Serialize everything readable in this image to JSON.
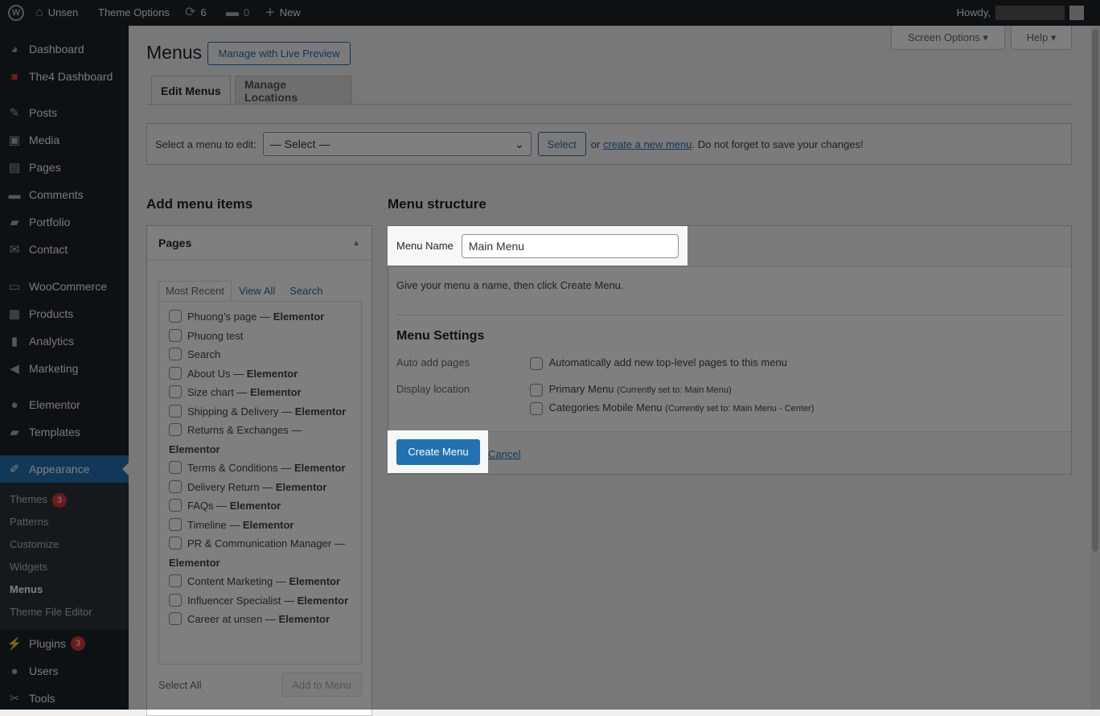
{
  "adminbar": {
    "site": "Unsen",
    "theme_options": "Theme Options",
    "updates": "6",
    "comments": "0",
    "new": "New",
    "howdy": "Howdy,"
  },
  "sidebar": [
    {
      "label": "Dashboard",
      "icon": "dashboard-icon",
      "glyph": "◕"
    },
    {
      "label": "The4 Dashboard",
      "icon": "the4-logo-icon",
      "glyph": "■",
      "sepAfter": true
    },
    {
      "label": "Posts",
      "icon": "pin-icon",
      "glyph": "✎"
    },
    {
      "label": "Media",
      "icon": "media-icon",
      "glyph": "▣"
    },
    {
      "label": "Pages",
      "icon": "pages-icon",
      "glyph": "▤"
    },
    {
      "label": "Comments",
      "icon": "comment-icon",
      "glyph": "▬"
    },
    {
      "label": "Portfolio",
      "icon": "folder-icon",
      "glyph": "▰"
    },
    {
      "label": "Contact",
      "icon": "mail-icon",
      "glyph": "✉",
      "sepAfter": true
    },
    {
      "label": "WooCommerce",
      "icon": "woo-icon",
      "glyph": "▭"
    },
    {
      "label": "Products",
      "icon": "archive-icon",
      "glyph": "▦"
    },
    {
      "label": "Analytics",
      "icon": "chart-icon",
      "glyph": "▮"
    },
    {
      "label": "Marketing",
      "icon": "megaphone-icon",
      "glyph": "◀",
      "sepAfter": true
    },
    {
      "label": "Elementor",
      "icon": "elementor-icon",
      "glyph": "●"
    },
    {
      "label": "Templates",
      "icon": "folder-icon",
      "glyph": "▰",
      "sepAfter": true
    },
    {
      "label": "Appearance",
      "icon": "brush-icon",
      "glyph": "✐",
      "current": true,
      "sub": [
        {
          "label": "Themes",
          "badge": "3"
        },
        {
          "label": "Patterns"
        },
        {
          "label": "Customize"
        },
        {
          "label": "Widgets"
        },
        {
          "label": "Menus",
          "active": true
        },
        {
          "label": "Theme File Editor"
        }
      ]
    },
    {
      "label": "Plugins",
      "icon": "plugin-icon",
      "glyph": "⚡",
      "badge": "3"
    },
    {
      "label": "Users",
      "icon": "user-icon",
      "glyph": "●"
    },
    {
      "label": "Tools",
      "icon": "wrench-icon",
      "glyph": "✂"
    }
  ],
  "header": {
    "title": "Menus",
    "live_preview": "Manage with Live Preview",
    "screen_options": "Screen Options ▾",
    "help": "Help ▾"
  },
  "tabs": {
    "edit": "Edit Menus",
    "locations": "Manage Locations"
  },
  "select_bar": {
    "label": "Select a menu to edit:",
    "value": "— Select —",
    "button": "Select",
    "or": "or",
    "create_link": "create a new menu",
    "suffix": ". Do not forget to save your changes!"
  },
  "add_items": {
    "title": "Add menu items",
    "panel": "Pages",
    "tabs": [
      "Most Recent",
      "View All",
      "Search"
    ],
    "pages": [
      [
        "Phuong’s page",
        "Elementor"
      ],
      [
        "Phuong test",
        ""
      ],
      [
        "Search",
        ""
      ],
      [
        "About Us",
        "Elementor"
      ],
      [
        "Size chart",
        "Elementor"
      ],
      [
        "Shipping & Delivery",
        "Elementor"
      ],
      [
        "Returns & Exchanges",
        "Elementor"
      ],
      [
        "Terms & Conditions",
        "Elementor"
      ],
      [
        "Delivery Return",
        "Elementor"
      ],
      [
        "FAQs",
        "Elementor"
      ],
      [
        "Timeline",
        "Elementor"
      ],
      [
        "PR & Communication Manager",
        "Elementor"
      ],
      [
        "Content Marketing",
        "Elementor"
      ],
      [
        "Influencer Specialist",
        "Elementor"
      ],
      [
        "Career at unsen",
        "Elementor"
      ]
    ],
    "select_all": "Select All",
    "add_button": "Add to Menu"
  },
  "structure": {
    "title": "Menu structure",
    "name_label": "Menu Name",
    "name_value": "Main Menu",
    "hint": "Give your menu a name, then click Create Menu.",
    "settings_title": "Menu Settings",
    "auto_label": "Auto add pages",
    "auto_text": "Automatically add new top-level pages to this menu",
    "display_label": "Display location",
    "locations": [
      {
        "name": "Primary Menu",
        "note": "(Currently set to: Main Menu)"
      },
      {
        "name": "Categories Mobile Menu",
        "note": "(Currently set to: Main Menu - Center)"
      }
    ],
    "create": "Create Menu",
    "cancel": "Cancel"
  },
  "colors": {
    "accent": "#2271b1",
    "sidebar": "#1d2327",
    "badge": "#d63638"
  }
}
